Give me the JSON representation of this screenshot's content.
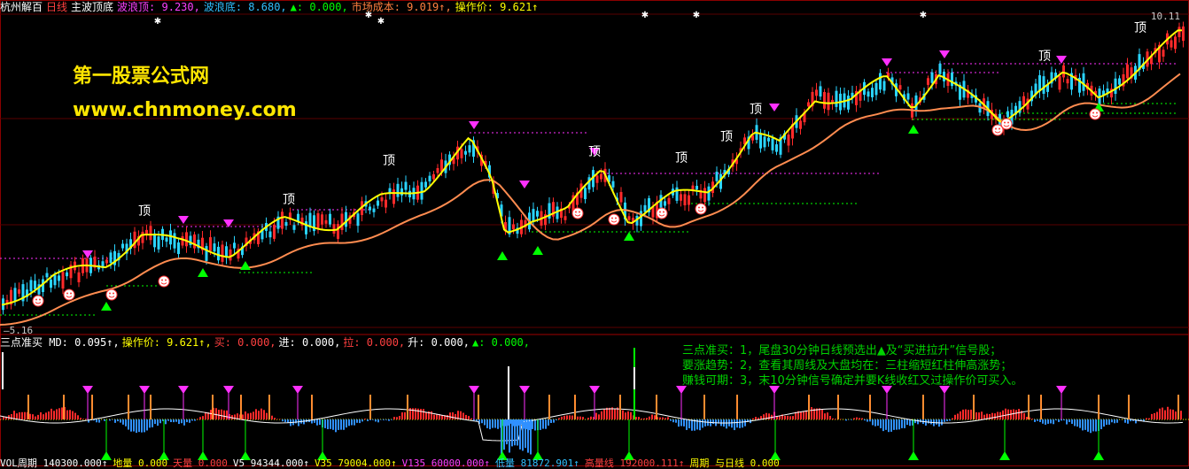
{
  "header": {
    "items": [
      {
        "text": "杭州解百",
        "color": "#ffffff"
      },
      {
        "text": "日线",
        "color": "#ff4040"
      },
      {
        "text": "主波顶底",
        "color": "#ffffff"
      },
      {
        "text": "波浪顶: 9.230,",
        "color": "#ff40ff"
      },
      {
        "text": "波浪底: 8.680,",
        "color": "#30c0ff"
      },
      {
        "text": "▲: 0.000,",
        "color": "#00ff00"
      },
      {
        "text": "市场成本: 9.019↑,",
        "color": "#ff8040"
      },
      {
        "text": "操作价: 9.621↑",
        "color": "#ffff00"
      }
    ]
  },
  "price_labels": {
    "high": "10.11",
    "low": "5.16"
  },
  "watermark": {
    "title": "第一股票公式网",
    "url": "www.chnmoney.com"
  },
  "top_label": "顶",
  "sub_header": {
    "items": [
      {
        "text": "三点准买 MD: 0.095↑,",
        "color": "#ffffff"
      },
      {
        "text": "操作价: 9.621↑,",
        "color": "#ffff00"
      },
      {
        "text": "买: 0.000,",
        "color": "#ff4040"
      },
      {
        "text": "进: 0.000,",
        "color": "#ffffff"
      },
      {
        "text": "拉: 0.000,",
        "color": "#ff4040"
      },
      {
        "text": "升: 0.000,",
        "color": "#ffffff"
      },
      {
        "text": "▲: 0.000,",
        "color": "#00ff00"
      }
    ]
  },
  "notes": [
    "三点准买：1，尾盘30分钟日线预选出▲及“买进拉升”信号股；",
    "要涨趋势：2，查看其周线及大盘均在：三柱缩短红柱伸高涨势；",
    "赚钱可期：3，末10分钟信号确定并要K线收红又过操作价可买入。"
  ],
  "footer": {
    "items": [
      {
        "text": "VOL周期  140300.000↑",
        "color": "#ffffff"
      },
      {
        "text": "地量  0.000",
        "color": "#ffff00"
      },
      {
        "text": "天量  0.000",
        "color": "#ff4040"
      },
      {
        "text": "V5  94344.000↑",
        "color": "#ffffff"
      },
      {
        "text": "V35  79004.000↑",
        "color": "#ffff00"
      },
      {
        "text": "V135  60000.000↑",
        "color": "#ff40ff"
      },
      {
        "text": "低量  81872.901↑",
        "color": "#30c0ff"
      },
      {
        "text": "高量线  192000.111↑",
        "color": "#ff4040"
      },
      {
        "text": "周期  与日线  0.000",
        "color": "#ffff00"
      }
    ]
  },
  "colors": {
    "up": "#ff2a2a",
    "down": "#2ad4ff",
    "ma": "#ff8c50",
    "wave": "#ffff00",
    "top_marker": "#ff30ff",
    "bottom_marker": "#00ff00",
    "smile": "#ff3030",
    "grid": "#8b0000"
  }
}
